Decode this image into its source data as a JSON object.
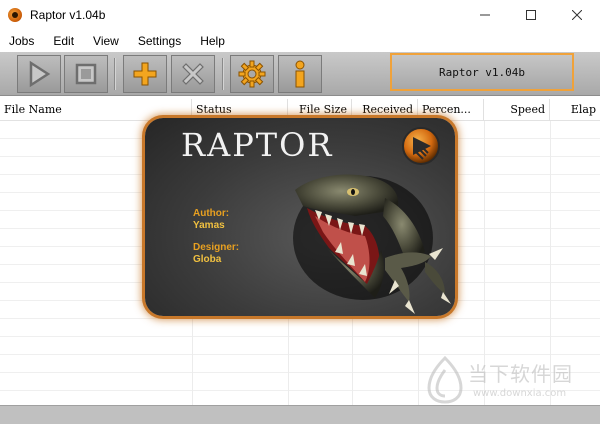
{
  "window": {
    "title": "Raptor v1.04b",
    "controls": [
      "minimize-icon",
      "maximize-icon",
      "close-icon"
    ]
  },
  "menu": [
    {
      "label": "Jobs"
    },
    {
      "label": "Edit"
    },
    {
      "label": "View"
    },
    {
      "label": "Settings"
    },
    {
      "label": "Help"
    }
  ],
  "toolbar": {
    "buttons": [
      {
        "name": "play-button",
        "icon": "play-icon"
      },
      {
        "name": "stop-button",
        "icon": "stop-icon"
      },
      {
        "name": "add-button",
        "icon": "plus-icon"
      },
      {
        "name": "remove-button",
        "icon": "cross-icon"
      },
      {
        "name": "settings-button",
        "icon": "gear-icon"
      },
      {
        "name": "info-button",
        "icon": "info-icon"
      }
    ],
    "version_label": "Raptor v1.04b",
    "accent": "#f0a23a"
  },
  "list": {
    "columns": [
      "File Name",
      "Status",
      "File Size",
      "Received",
      "Percen...",
      "Speed",
      "Elap"
    ]
  },
  "splash": {
    "title": "RAPTOR",
    "author_label": "Author:",
    "author": "Yamas",
    "designer_label": "Designer:",
    "designer": "Globa",
    "label_color": "#e8a020"
  },
  "watermark": {
    "text": "当下软件园",
    "url": "www.downxia.com"
  }
}
